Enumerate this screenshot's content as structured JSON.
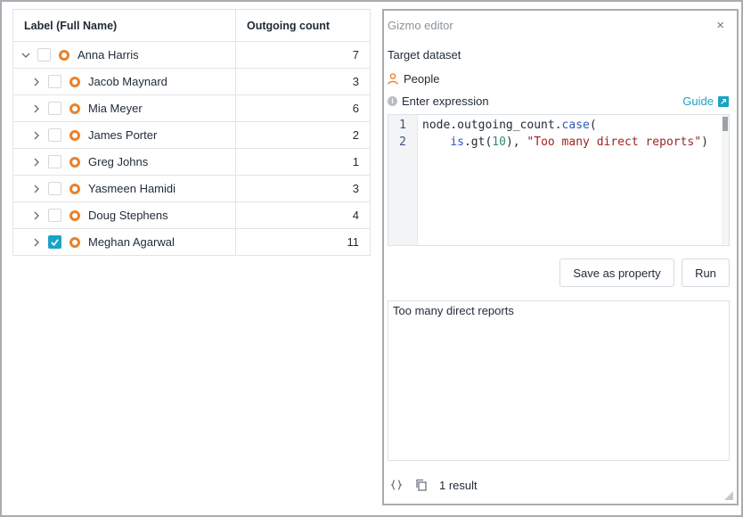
{
  "table": {
    "headers": {
      "label": "Label (Full Name)",
      "count": "Outgoing count"
    },
    "rows": [
      {
        "name": "Anna Harris",
        "count": "7",
        "level": 0,
        "expanded": true,
        "checked": false
      },
      {
        "name": "Jacob Maynard",
        "count": "3",
        "level": 1,
        "expanded": false,
        "checked": false
      },
      {
        "name": "Mia Meyer",
        "count": "6",
        "level": 1,
        "expanded": false,
        "checked": false
      },
      {
        "name": "James Porter",
        "count": "2",
        "level": 1,
        "expanded": false,
        "checked": false
      },
      {
        "name": "Greg Johns",
        "count": "1",
        "level": 1,
        "expanded": false,
        "checked": false
      },
      {
        "name": "Yasmeen Hamidi",
        "count": "3",
        "level": 1,
        "expanded": false,
        "checked": false
      },
      {
        "name": "Doug Stephens",
        "count": "4",
        "level": 1,
        "expanded": false,
        "checked": false
      },
      {
        "name": "Meghan Agarwal",
        "count": "11",
        "level": 1,
        "expanded": false,
        "checked": true
      }
    ]
  },
  "editor": {
    "title": "Gizmo editor",
    "close": "×",
    "dataset_label": "Target dataset",
    "dataset": "People",
    "expression_label": "Enter expression",
    "guide": "Guide",
    "code": {
      "line_numbers": [
        "1",
        "2"
      ],
      "line1": {
        "a": "node.outgoing_count.",
        "b": "case",
        "c": "("
      },
      "line2": {
        "a": "    ",
        "b": "is",
        "c": ".gt(",
        "d": "10",
        "e": "), ",
        "f": "\"Too many direct reports\"",
        "g": ")"
      }
    },
    "save_label": "Save as property",
    "run_label": "Run",
    "output": "Too many direct reports",
    "result_count": "1 result"
  },
  "colors": {
    "accent": "#1aa3c4",
    "node": "#e8822e"
  }
}
